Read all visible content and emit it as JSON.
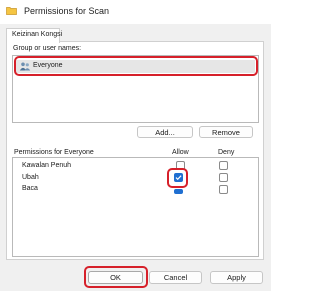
{
  "window": {
    "title": "Permissions for Scan",
    "icon": "folder-icon"
  },
  "tabs": [
    {
      "label": "Keizinan Kongsi",
      "selected": true
    }
  ],
  "groups": {
    "label": "Group or user names:",
    "items": [
      {
        "name": "Everyone",
        "icon": "users-group-icon",
        "selected": true
      }
    ],
    "add_label": "Add...",
    "remove_label": "Remove"
  },
  "permissions": {
    "label": "Permissions for Everyone",
    "allow_label": "Allow",
    "deny_label": "Deny",
    "rows": [
      {
        "name": "Kawalan Penuh",
        "allow": false,
        "deny": false
      },
      {
        "name": "Ubah",
        "allow": true,
        "deny": false
      },
      {
        "name": "Baca",
        "allow": true,
        "deny": false
      }
    ]
  },
  "footer": {
    "ok_label": "OK",
    "cancel_label": "Cancel",
    "apply_label": "Apply"
  },
  "colors": {
    "accent": "#1f6fd1",
    "highlight": "#d6202a"
  }
}
